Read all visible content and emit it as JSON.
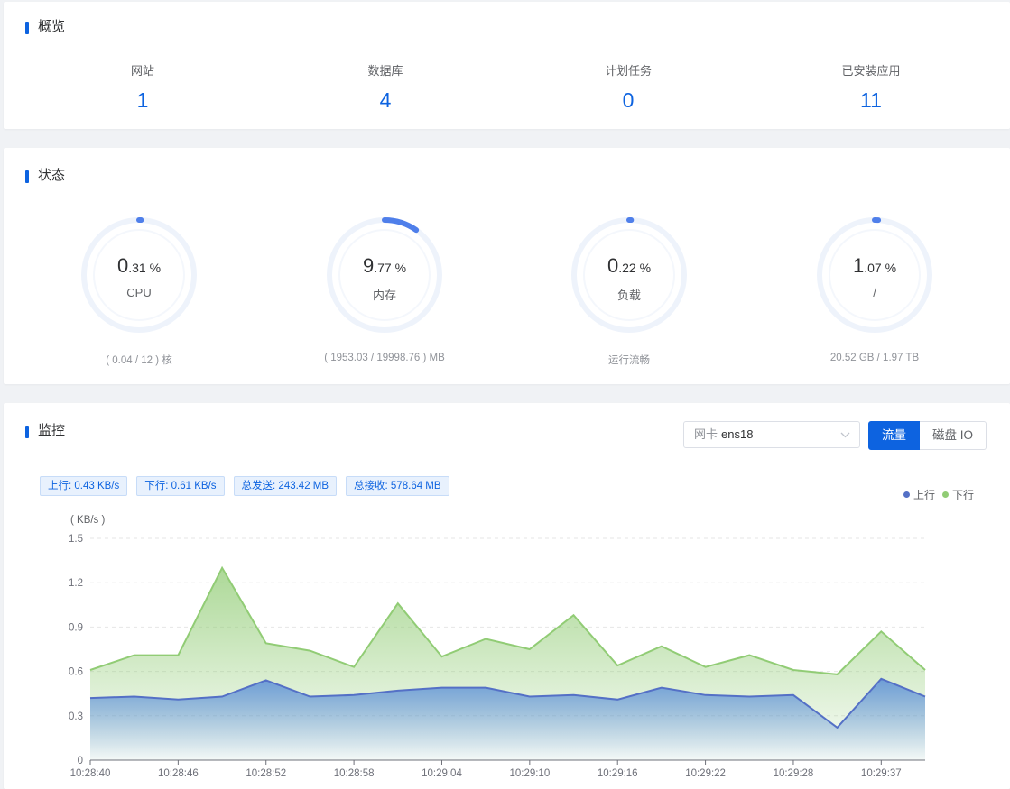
{
  "overview": {
    "title": "概览",
    "items": [
      {
        "label": "网站",
        "value": "1"
      },
      {
        "label": "数据库",
        "value": "4"
      },
      {
        "label": "计划任务",
        "value": "0"
      },
      {
        "label": "已安装应用",
        "value": "11"
      }
    ]
  },
  "status": {
    "title": "状态",
    "gauges": [
      {
        "int": "0",
        "frac": ".31 %",
        "label": "CPU",
        "sub": "( 0.04 / 12 ) 核",
        "percent": 0.31
      },
      {
        "int": "9",
        "frac": ".77 %",
        "label": "内存",
        "sub": "( 1953.03 / 19998.76 ) MB",
        "percent": 9.77
      },
      {
        "int": "0",
        "frac": ".22 %",
        "label": "负载",
        "sub": "运行流畅",
        "percent": 0.22
      },
      {
        "int": "1",
        "frac": ".07 %",
        "label": "/",
        "sub": "20.52 GB / 1.97 TB",
        "percent": 1.07
      }
    ]
  },
  "monitor": {
    "title": "监控",
    "select": {
      "prefix": "网卡",
      "value": "ens18"
    },
    "buttons": {
      "traffic": "流量",
      "disk_io": "磁盘 IO"
    },
    "tags": {
      "up": "上行: 0.43 KB/s",
      "down": "下行: 0.61 KB/s",
      "sent": "总发送: 243.42 MB",
      "recv": "总接收: 578.64 MB"
    }
  },
  "colors": {
    "accent": "#0d63e0",
    "up": "#5470c6",
    "down": "#91cc75"
  },
  "chart_data": {
    "type": "area",
    "ylabel": "( KB/s )",
    "ylim": [
      0,
      1.5
    ],
    "yticks": [
      "0",
      "0.3",
      "0.6",
      "0.9",
      "1.2",
      "1.5"
    ],
    "xtick_labels": [
      "10:28:40",
      "10:28:46",
      "10:28:52",
      "10:28:58",
      "10:29:04",
      "10:29:10",
      "10:29:16",
      "10:29:22",
      "10:29:28",
      "10:29:37"
    ],
    "legend": "top-right",
    "series": [
      {
        "name": "上行",
        "values": [
          0.42,
          0.43,
          0.41,
          0.43,
          0.54,
          0.43,
          0.44,
          0.47,
          0.49,
          0.49,
          0.43,
          0.44,
          0.41,
          0.49,
          0.44,
          0.43,
          0.44,
          0.22,
          0.55,
          0.43
        ]
      },
      {
        "name": "下行",
        "values": [
          0.61,
          0.71,
          0.71,
          1.3,
          0.79,
          0.74,
          0.63,
          1.06,
          0.7,
          0.82,
          0.75,
          0.98,
          0.64,
          0.77,
          0.63,
          0.71,
          0.61,
          0.58,
          0.87,
          0.61
        ]
      }
    ]
  }
}
